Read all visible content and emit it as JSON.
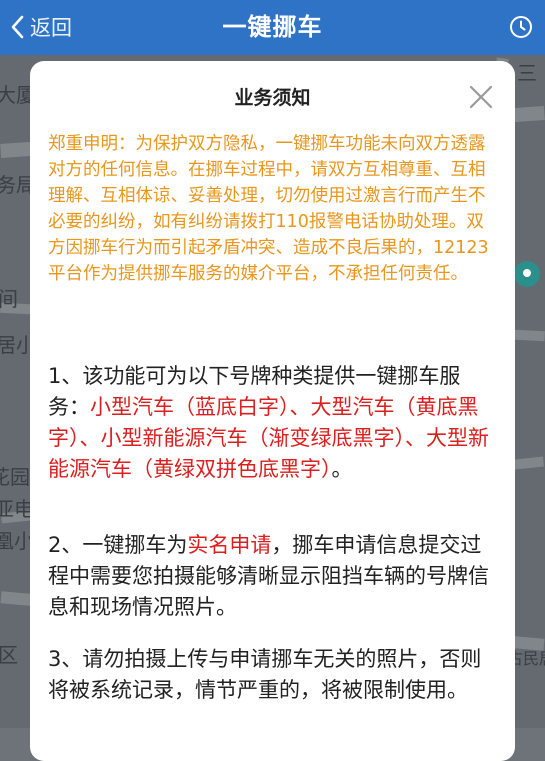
{
  "header": {
    "back_label": "返回",
    "title": "一键挪车",
    "icons": {
      "back": "chevron-left-icon",
      "history": "clock-icon"
    },
    "background": "#2f73c7"
  },
  "map": {
    "labels": [
      "三",
      "大厦",
      "务局",
      "间",
      "居小",
      "花园",
      "亚电",
      "凰小",
      "区",
      "古民居"
    ],
    "pin_icon": "location-pin-icon"
  },
  "modal": {
    "title": "业务须知",
    "close_icon": "close-icon",
    "notice": "郑重申明：为保护双方隐私，一键挪车功能未向双方透露对方的任何信息。在挪车过程中，请双方互相尊重、互相理解、互相体谅、妥善处理，切勿使用过激言行而产生不必要的纠纷，如有纠纷请拨打110报警电话协助处理。双方因挪车行为而引起矛盾冲突、造成不良后果的，12123平台作为提供挪车服务的媒介平台，不承担任何责任。",
    "notice_color": "#e8961d",
    "highlight_color": "#d9201f",
    "item1": {
      "prefix": "1、该功能可为以下号牌种类提供一键挪车服务：",
      "highlight": "小型汽车（蓝底白字）、大型汽车（黄底黑字）、小型新能源汽车（渐变绿底黑字）、大型新能源汽车（黄绿双拼色底黑字）",
      "suffix": "。"
    },
    "item2": {
      "prefix": "2、一键挪车为",
      "highlight": "实名申请",
      "suffix": "，挪车申请信息提交过程中需要您拍摄能够清晰显示阻挡车辆的号牌信息和现场情况照片。"
    },
    "item3": {
      "text": "3、请勿拍摄上传与申请挪车无关的照片，否则将被系统记录，情节严重的，将被限制使用。"
    }
  }
}
